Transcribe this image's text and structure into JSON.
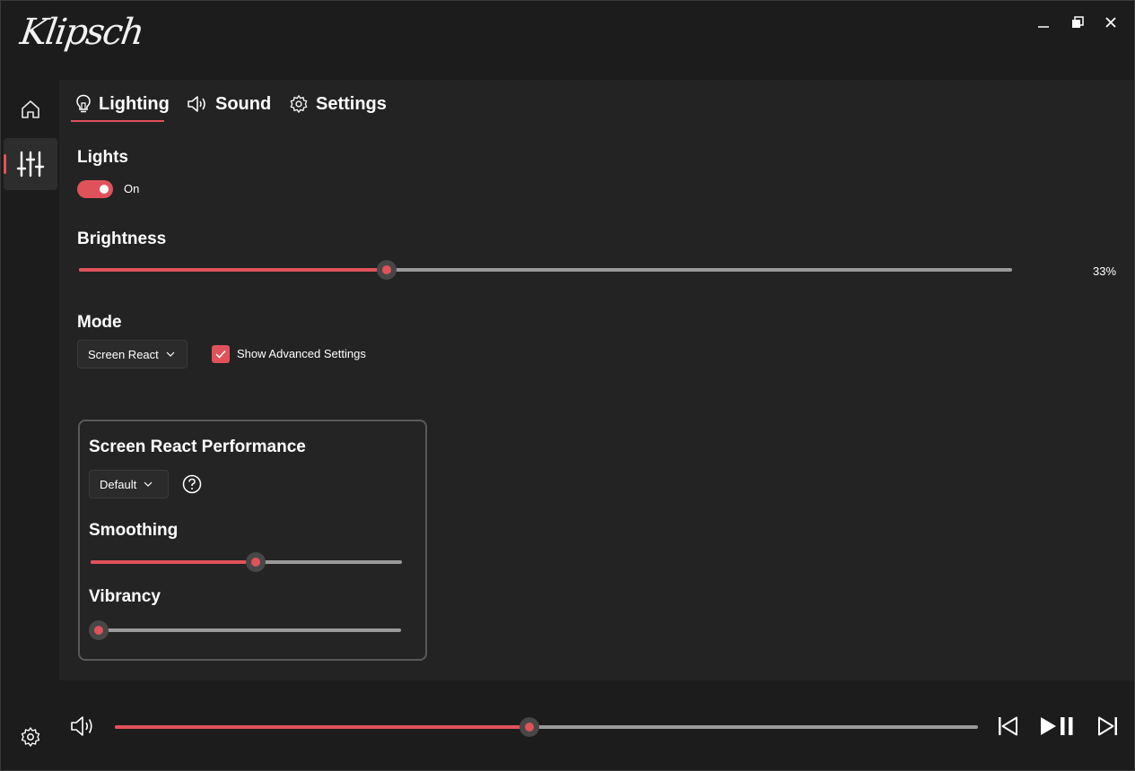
{
  "app": {
    "logo_text": "Klipsch",
    "window_controls": [
      "minimize",
      "restore",
      "close"
    ]
  },
  "nav": {
    "items": [
      {
        "name": "home",
        "icon": "home-icon"
      },
      {
        "name": "equalizer",
        "icon": "sliders-icon",
        "active": true
      }
    ],
    "settings_icon": "gear-icon"
  },
  "tabs": [
    {
      "label": "Lighting",
      "icon": "lightbulb-icon",
      "active": true
    },
    {
      "label": "Sound",
      "icon": "speaker-icon"
    },
    {
      "label": "Settings",
      "icon": "gear-icon"
    }
  ],
  "lights": {
    "label": "Lights",
    "toggle_state": "On",
    "toggle_on": true
  },
  "brightness": {
    "label": "Brightness",
    "value_percent": 33,
    "value_text": "33%"
  },
  "mode": {
    "label": "Mode",
    "selected": "Screen React",
    "advanced_checkbox_label": "Show Advanced Settings",
    "advanced_checked": true
  },
  "performance_panel": {
    "title": "Screen React Performance",
    "preset_selected": "Default",
    "smoothing_label": "Smoothing",
    "smoothing_value": 0.53,
    "vibrancy_label": "Vibrancy",
    "vibrancy_value": 0.0
  },
  "playback": {
    "volume_value": 0.48,
    "controls": [
      "previous-track",
      "play-pause",
      "next-track"
    ]
  },
  "colors": {
    "accent": "#e0525a",
    "background": "#1c1c1c",
    "content_bg": "#232323"
  }
}
